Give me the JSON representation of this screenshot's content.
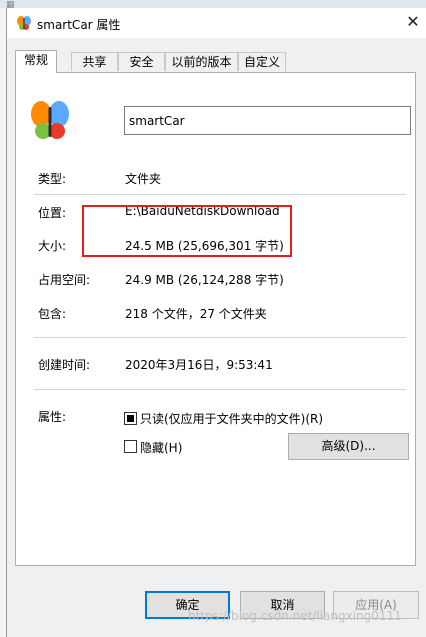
{
  "window": {
    "title": "smartCar 属性",
    "close_glyph": "✕"
  },
  "tabs": [
    {
      "label": "常规",
      "active": true
    },
    {
      "label": "共享",
      "active": false
    },
    {
      "label": "安全",
      "active": false
    },
    {
      "label": "以前的版本",
      "active": false
    },
    {
      "label": "自定义",
      "active": false
    }
  ],
  "general": {
    "name_value": "smartCar",
    "type": {
      "label": "类型:",
      "value": "文件夹"
    },
    "location": {
      "label": "位置:",
      "value": "E:\\BaiduNetdiskDownload"
    },
    "size": {
      "label": "大小:",
      "value": "24.5 MB (25,696,301 字节)"
    },
    "size_on_disk": {
      "label": "占用空间:",
      "value": "24.9 MB (26,124,288 字节)"
    },
    "contains": {
      "label": "包含:",
      "value": "218 个文件，27 个文件夹"
    },
    "created": {
      "label": "创建时间:",
      "value": "2020年3月16日，9:53:41"
    },
    "attributes": {
      "label": "属性:",
      "readonly_label": "只读(仅应用于文件夹中的文件)(R)",
      "readonly_checked": true,
      "hidden_label": "隐藏(H)",
      "hidden_checked": false,
      "advanced_label": "高级(D)..."
    }
  },
  "buttons": {
    "ok": "确定",
    "cancel": "取消",
    "apply": "应用(A)"
  },
  "watermark": "https://blog.csdn.net/liangxing0111",
  "colors": {
    "highlight_box": "#e02020",
    "default_button_border": "#0078d7"
  },
  "icons": {
    "app": "msn-butterfly-icon",
    "close": "close-icon"
  }
}
